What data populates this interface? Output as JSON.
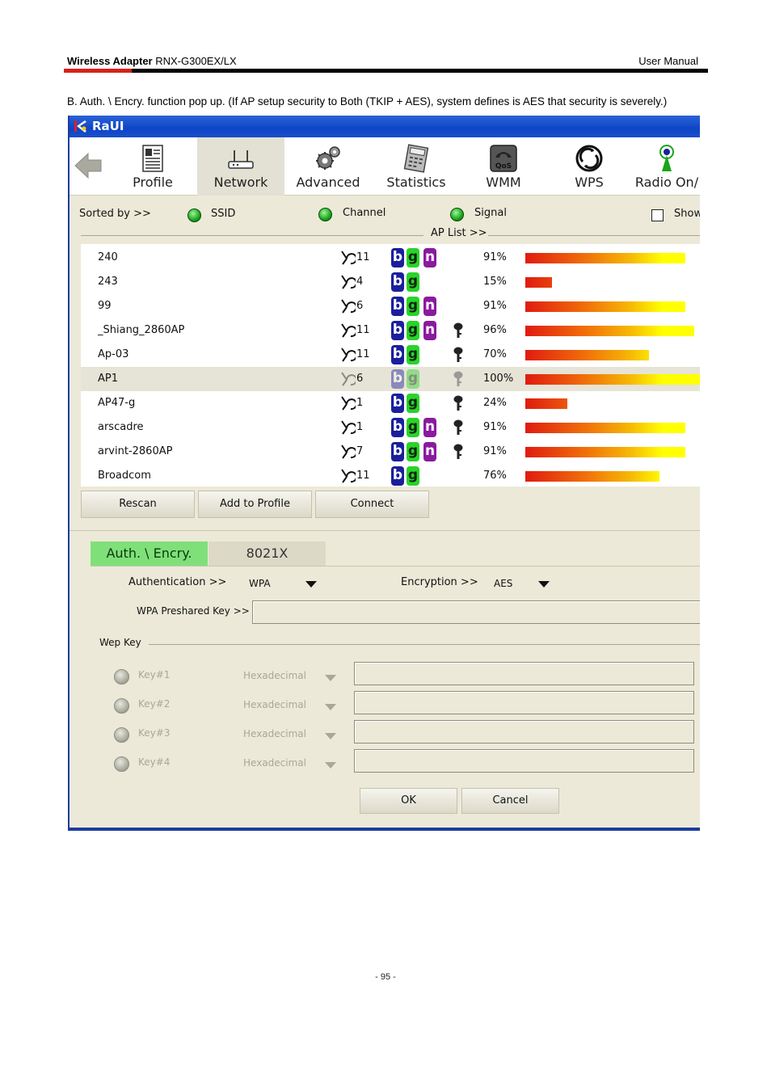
{
  "page_header": {
    "left_bold": "Wireless Adapter",
    "left_model": " RNX-G300EX/LX",
    "right": "User Manual"
  },
  "intro_text": "B. Auth. \\ Encry. function pop up. (If AP setup security to Both (TKIP + AES), system defines is AES that security is severely.)",
  "window": {
    "title": "RaUI",
    "toolbar": [
      {
        "label": "Profile",
        "icon": "profile-icon"
      },
      {
        "label": "Network",
        "icon": "network-icon",
        "active": true
      },
      {
        "label": "Advanced",
        "icon": "advanced-icon"
      },
      {
        "label": "Statistics",
        "icon": "statistics-icon"
      },
      {
        "label": "WMM",
        "icon": "qos-icon"
      },
      {
        "label": "WPS",
        "icon": "wps-icon"
      },
      {
        "label": "Radio On/",
        "icon": "radio-icon"
      }
    ],
    "sort": {
      "sorted_by": "Sorted by >>",
      "ssid": "SSID",
      "channel": "Channel",
      "signal": "Signal",
      "show": "Show"
    },
    "ap_list_label": "AP List >>",
    "ap_list": [
      {
        "ssid": "240",
        "channel": "11",
        "modes": [
          "b",
          "g",
          "n"
        ],
        "secured": false,
        "signal_label": "91%",
        "signal": 91,
        "selected": false
      },
      {
        "ssid": "243",
        "channel": "4",
        "modes": [
          "b",
          "g"
        ],
        "secured": false,
        "signal_label": "15%",
        "signal": 15,
        "selected": false
      },
      {
        "ssid": "99",
        "channel": "6",
        "modes": [
          "b",
          "g",
          "n"
        ],
        "secured": false,
        "signal_label": "91%",
        "signal": 91,
        "selected": false
      },
      {
        "ssid": "_Shiang_2860AP",
        "channel": "11",
        "modes": [
          "b",
          "g",
          "n"
        ],
        "secured": true,
        "signal_label": "96%",
        "signal": 96,
        "selected": false
      },
      {
        "ssid": "Ap-03",
        "channel": "11",
        "modes": [
          "b",
          "g"
        ],
        "secured": true,
        "signal_label": "70%",
        "signal": 70,
        "selected": false
      },
      {
        "ssid": "AP1",
        "channel": "6",
        "modes": [
          "b",
          "g"
        ],
        "secured": true,
        "signal_label": "100%",
        "signal": 100,
        "selected": true
      },
      {
        "ssid": "AP47-g",
        "channel": "1",
        "modes": [
          "b",
          "g"
        ],
        "secured": true,
        "signal_label": "24%",
        "signal": 24,
        "selected": false
      },
      {
        "ssid": "arscadre",
        "channel": "1",
        "modes": [
          "b",
          "g",
          "n"
        ],
        "secured": true,
        "signal_label": "91%",
        "signal": 91,
        "selected": false
      },
      {
        "ssid": "arvint-2860AP",
        "channel": "7",
        "modes": [
          "b",
          "g",
          "n"
        ],
        "secured": true,
        "signal_label": "91%",
        "signal": 91,
        "selected": false
      },
      {
        "ssid": "Broadcom",
        "channel": "11",
        "modes": [
          "b",
          "g"
        ],
        "secured": false,
        "signal_label": "76%",
        "signal": 76,
        "selected": false
      }
    ],
    "buttons": {
      "rescan": "Rescan",
      "add_to_profile": "Add to Profile",
      "connect": "Connect"
    },
    "tabs": {
      "auth": "Auth. \\ Encry.",
      "x8021": "8021X"
    },
    "auth": {
      "authentication_label": "Authentication >>",
      "authentication_value": "WPA",
      "encryption_label": "Encryption >>",
      "encryption_value": "AES",
      "psk_label": "WPA Preshared Key >>",
      "psk_value": ""
    },
    "wep": {
      "title": "Wep Key",
      "keys": [
        {
          "label": "Key#1",
          "format": "Hexadecimal",
          "value": ""
        },
        {
          "label": "Key#2",
          "format": "Hexadecimal",
          "value": ""
        },
        {
          "label": "Key#3",
          "format": "Hexadecimal",
          "value": ""
        },
        {
          "label": "Key#4",
          "format": "Hexadecimal",
          "value": ""
        }
      ]
    },
    "dialog_buttons": {
      "ok": "OK",
      "cancel": "Cancel"
    }
  },
  "page_number": "- 95 -",
  "colors": {
    "title_blue": "#0e45c8",
    "green_tab": "#7fe07a",
    "badge_b": "#1b1f9c",
    "badge_g": "#2ad32a",
    "badge_n": "#8a1a9e",
    "header_red": "#d7201a"
  }
}
